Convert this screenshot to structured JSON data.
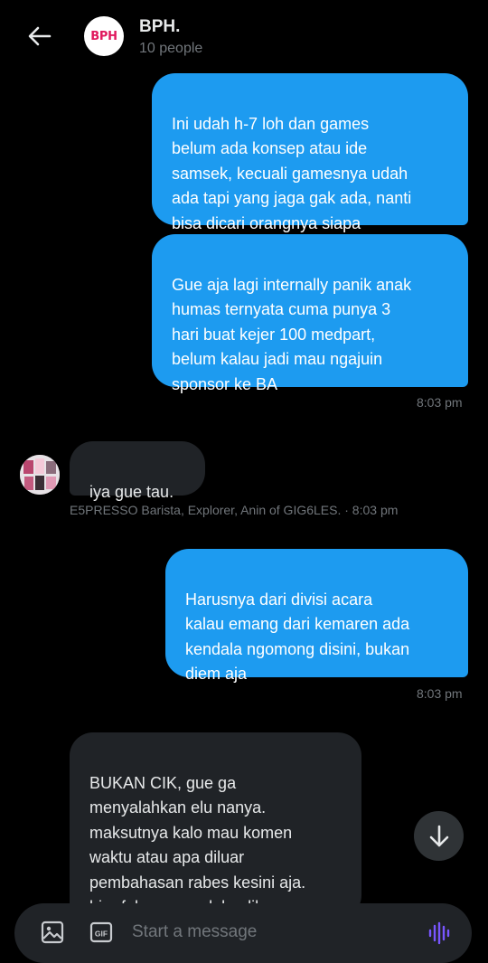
{
  "header": {
    "title": "BPH.",
    "subtitle": "10 people",
    "avatar_text": "BPH"
  },
  "messages": [
    {
      "id": "m1",
      "direction": "outgoing",
      "text": "Ini udah h-7 loh dan games\nbelum ada konsep atau ide\nsamsek, kecuali gamesnya udah\nada tapi yang jaga gak ada, nanti\nbisa dicari orangnya siapa"
    },
    {
      "id": "m2",
      "direction": "outgoing",
      "text": "Gue aja lagi internally panik anak\nhumas ternyata cuma punya 3\nhari buat kejer 100 medpart,\nbelum kalau jadi mau ngajuin\nsponsor ke BA",
      "time": "8:03 pm"
    },
    {
      "id": "m3",
      "direction": "incoming",
      "text": "iya gue tau.",
      "meta": "E5PRESSO Barista, Explorer, Anin of GIG6LES. · 8:03 pm"
    },
    {
      "id": "m4",
      "direction": "outgoing",
      "text": "Harusnya dari divisi acara\nkalau emang dari kemaren ada\nkendala ngomong disini, bukan\ndiem aja",
      "time": "8:03 pm"
    },
    {
      "id": "m5",
      "direction": "incoming",
      "text": "BUKAN CIK, gue ga\nmenyalahkan elu nanya.\nmaksutnya kalo mau komen\nwaktu atau apa diluar\npembahasan rabes kesini aja.\nbiar fokusnya gak kealih."
    }
  ],
  "composer": {
    "placeholder": "Start a message",
    "gif_label": "GIF"
  },
  "colors": {
    "accent": "#1d9bf0",
    "incoming_bubble": "#202327",
    "background": "#000000",
    "avatar_text": "#e0185e"
  },
  "icons": {
    "back": "arrow-left-icon",
    "scroll": "arrow-down-icon",
    "media": "image-icon",
    "gif": "gif-icon",
    "voice": "voice-wave-icon"
  }
}
